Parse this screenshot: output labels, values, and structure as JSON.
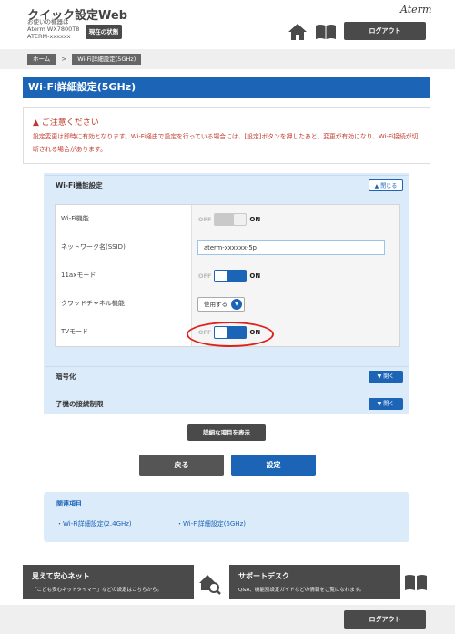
{
  "header": {
    "app_title": "クイック設定Web",
    "device_caption": "お使いの機器は",
    "device_model": "Aterm WX7800T8",
    "device_name": "ATERM-xxxxxx",
    "status_button": "現在の状態",
    "brand": "Aterm",
    "logout": "ログアウト"
  },
  "breadcrumb": {
    "home": "ホーム",
    "separator": ">",
    "current": "Wi-Fi詳細設定(5GHz)"
  },
  "page_title": "Wi-Fi詳細設定(5GHz)",
  "caution": {
    "title": "ご注意ください",
    "text": "設定変更は即時に有効となります。Wi-Fi経由で設定を行っている場合には、[設定]ボタンを押したあと、変更が有効になり、Wi-Fi接続が切断される場合があります。"
  },
  "wifi_section": {
    "title": "Wi-Fi機能設定",
    "collapse_label": "閉じる",
    "rows": [
      {
        "label": "Wi-Fi機能",
        "type": "switch",
        "on": false
      },
      {
        "label": "ネットワーク名(SSID)",
        "type": "input",
        "value": "aterm-xxxxxx-5p"
      },
      {
        "label": "11axモード",
        "type": "switch",
        "on": true
      },
      {
        "label": "クワッドチャネル機能",
        "type": "select",
        "value": "使用する"
      },
      {
        "label": "TVモード",
        "type": "switch",
        "on": true
      }
    ],
    "off_label": "OFF",
    "on_label": "ON"
  },
  "encryption_section": {
    "title": "暗号化",
    "expand_label": "開く"
  },
  "child_limit_section": {
    "title": "子機の接続制限",
    "expand_label": "開く"
  },
  "buttons": {
    "show_details": "詳細な項目を表示",
    "back": "戻る",
    "apply": "設定"
  },
  "related": {
    "title": "関連項目",
    "links": [
      "Wi-Fi詳細設定(2.4GHz)",
      "Wi-Fi詳細設定(6GHz)"
    ]
  },
  "promos": [
    {
      "title": "見えて安心ネット",
      "desc": "「こども安心ネットタイマー」などの設定はこちらから。",
      "icon": "home-search-icon"
    },
    {
      "title": "サポートデスク",
      "desc": "Q&A、機能別設定ガイドなどの情報をご覧になれます。",
      "icon": "book-icon"
    }
  ],
  "footer": {
    "logout": "ログアウト"
  },
  "colors": {
    "accent": "#1b64b6",
    "dark_button": "#4a4a4a",
    "panel": "#dcebfa",
    "warning": "#c0392b",
    "highlight": "#e0201b"
  }
}
